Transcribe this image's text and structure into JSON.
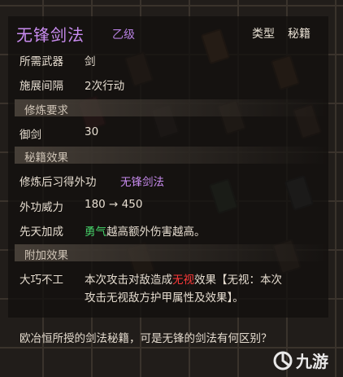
{
  "skill": {
    "name": "无锋剑法",
    "grade": "乙级",
    "type_label": "类型",
    "type_value": "秘籍"
  },
  "attributes": [
    {
      "label": "所需武器",
      "value": "剑"
    },
    {
      "label": "施展间隔",
      "value": "2次行动"
    }
  ],
  "sections": {
    "requirements": "修炼要求",
    "effects": "秘籍效果",
    "extra": "附加效果"
  },
  "requirement": {
    "label": "御剑",
    "value": "30"
  },
  "effects": {
    "learn_label": "修炼后习得外功",
    "learn_value": "无锋剑法",
    "power_label": "外功威力",
    "power_value": "180 → 450",
    "innate_label": "先天加成",
    "innate_highlight": "勇气",
    "innate_text": "越高额外伤害越高。"
  },
  "extra": {
    "label": "大巧不工",
    "line1_a": "本次攻击对敌造成",
    "line1_red": "无视",
    "line1_b": "效果【无视：本次",
    "line2": "攻击无视敌方护甲属性及效果】。"
  },
  "description": "欧冶恒所授的剑法秘籍，可是无锋的剑法有何区别？",
  "watermark": "九游",
  "colors": {
    "title_purple": "#c98cf0",
    "green_highlight": "#46d36a",
    "red_highlight": "#ff3a3a"
  }
}
